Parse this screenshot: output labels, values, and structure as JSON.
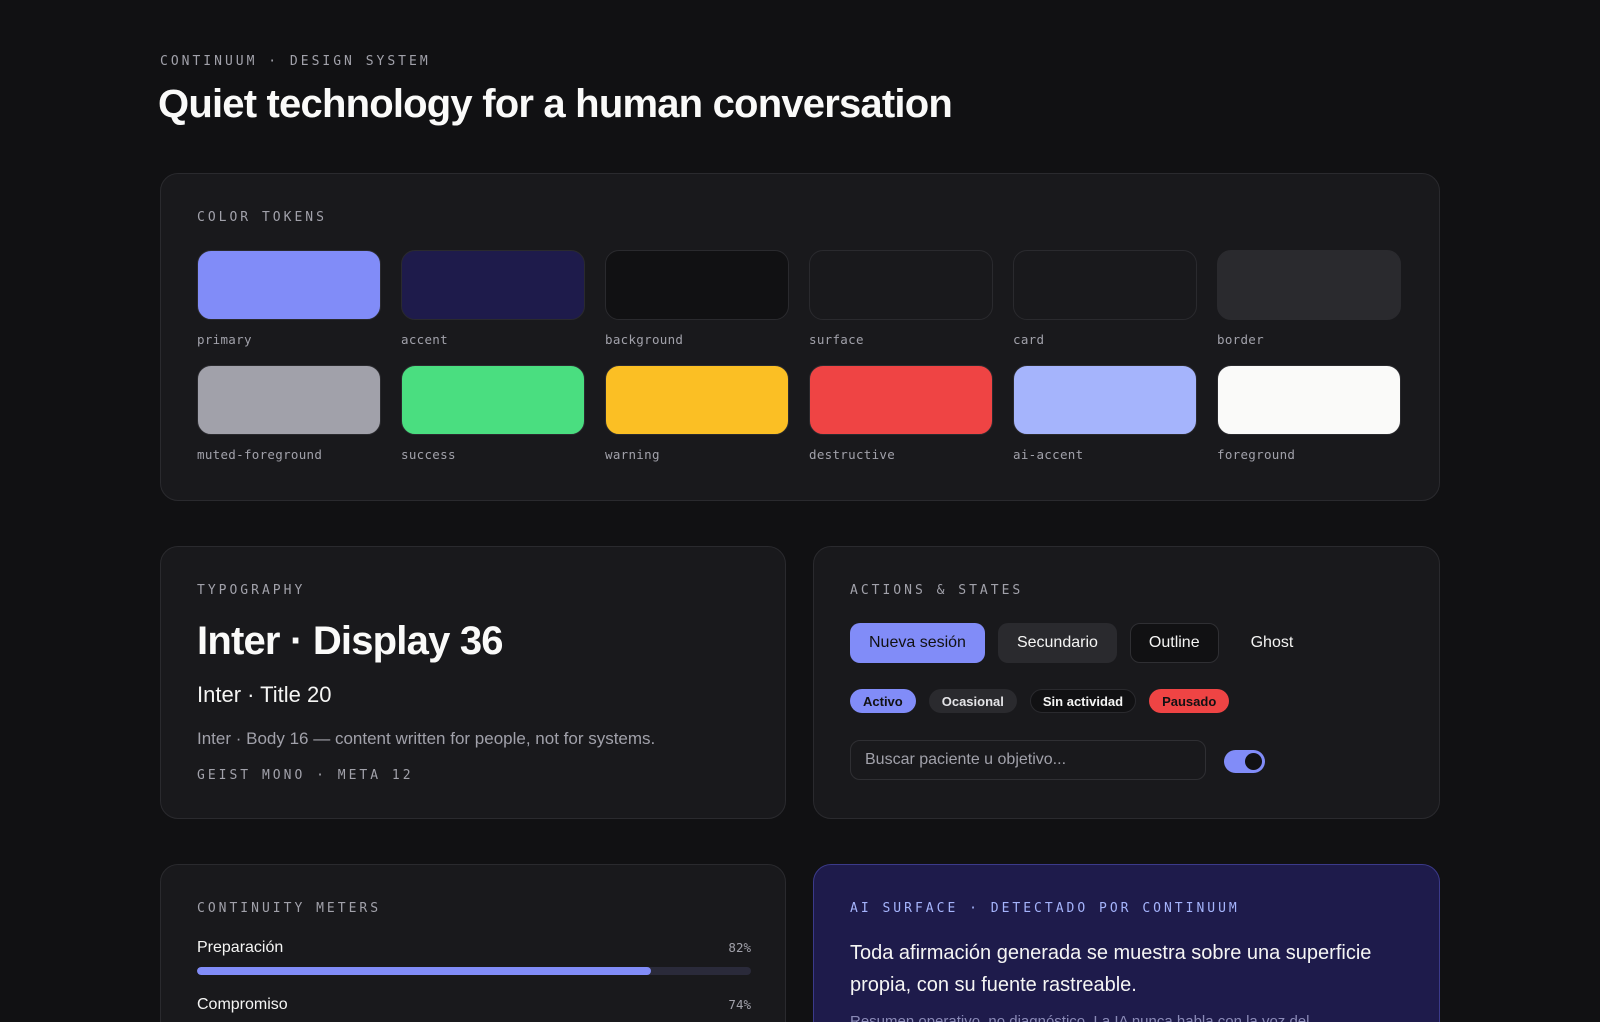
{
  "header": {
    "eyebrow": "CONTINUUM · DESIGN SYSTEM",
    "title": "Quiet technology for a human conversation"
  },
  "colors": {
    "label": "COLOR TOKENS",
    "tokens": [
      {
        "name": "primary",
        "hex": "#818cf8"
      },
      {
        "name": "accent",
        "hex": "#1e1b4b"
      },
      {
        "name": "background",
        "hex": "#111113"
      },
      {
        "name": "surface",
        "hex": "#19191c"
      },
      {
        "name": "card",
        "hex": "#19191c"
      },
      {
        "name": "border",
        "hex": "#2a2a2e"
      },
      {
        "name": "muted-foreground",
        "hex": "#a1a1aa"
      },
      {
        "name": "success",
        "hex": "#4ade80"
      },
      {
        "name": "warning",
        "hex": "#fbbf24"
      },
      {
        "name": "destructive",
        "hex": "#ef4444"
      },
      {
        "name": "ai-accent",
        "hex": "#a5b4fc"
      },
      {
        "name": "foreground",
        "hex": "#fafaf9"
      }
    ]
  },
  "typography": {
    "label": "TYPOGRAPHY",
    "display": "Inter · Display 36",
    "title": "Inter · Title 20",
    "body": "Inter · Body 16 — content written for people, not for systems.",
    "meta": "GEIST MONO · META 12"
  },
  "actions": {
    "label": "ACTIONS & STATES",
    "buttons": {
      "primary": "Nueva sesión",
      "secondary": "Secundario",
      "outline": "Outline",
      "ghost": "Ghost"
    },
    "badges": {
      "active": "Activo",
      "occasional": "Ocasional",
      "none": "Sin actividad",
      "paused": "Pausado"
    },
    "search": {
      "value": "",
      "placeholder": "Buscar paciente u objetivo..."
    },
    "toggle": {
      "on": true
    }
  },
  "meters": {
    "label": "CONTINUITY METERS",
    "items": [
      {
        "label": "Preparación",
        "value": "82%",
        "fraction": 0.82
      },
      {
        "label": "Compromiso",
        "value": "74%",
        "fraction": 0.74
      }
    ]
  },
  "ai": {
    "label": "AI SURFACE · DETECTADO POR CONTINUUM",
    "text": "Toda afirmación generada se muestra sobre una superficie propia, con su fuente rastreable.",
    "sub": "Resumen operativo, no diagnóstico. La IA nunca habla con la voz del"
  }
}
